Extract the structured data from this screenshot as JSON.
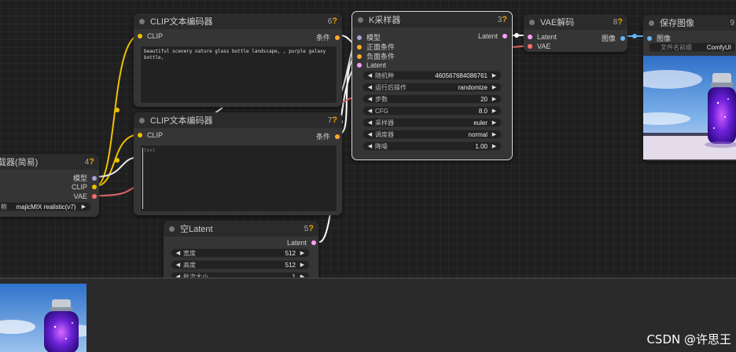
{
  "colors": {
    "clip": "#f0c000",
    "conditioning": "#ffa931",
    "model": "#b39ddb",
    "latent": "#ff9cf9",
    "vae": "#ff6e6e",
    "image": "#64b5f6"
  },
  "nodes": {
    "clip_text_pos": {
      "title": "CLIP文本编码器",
      "id": "6",
      "q": "?",
      "input_clip": "CLIP",
      "output": "条件",
      "text": "beautiful scenery nature glass bottle landscape, , purple galaxy bottle,"
    },
    "clip_text_neg": {
      "title": "CLIP文本编码器",
      "id": "7",
      "q": "?",
      "input_clip": "CLIP",
      "output": "条件",
      "text": "text"
    },
    "ksampler": {
      "title": "K采样器",
      "id": "3",
      "q": "?",
      "inputs": [
        "模型",
        "正面条件",
        "负面条件",
        "Latent"
      ],
      "output": "Latent",
      "widgets": [
        {
          "label": "随机种",
          "value": "460567684086761"
        },
        {
          "label": "运行后操作",
          "value": "randomize"
        },
        {
          "label": "步数",
          "value": "20"
        },
        {
          "label": "CFG",
          "value": "8.0"
        },
        {
          "label": "采样器",
          "value": "euler"
        },
        {
          "label": "调度器",
          "value": "normal"
        },
        {
          "label": "降噪",
          "value": "1.00"
        }
      ]
    },
    "vae_decode": {
      "title": "VAE解码",
      "id": "8",
      "q": "?",
      "inputs": [
        "Latent",
        "VAE"
      ],
      "output": "图像"
    },
    "save_image": {
      "title": "保存图像",
      "id": "9",
      "input": "图像",
      "widget_label": "文件名前缀",
      "widget_value": "ComfyUI"
    },
    "checkpoint_loader": {
      "title": "载器(简易)",
      "id": "4",
      "q": "?",
      "outputs": [
        "模型",
        "CLIP",
        "VAE"
      ],
      "widget_label": "称",
      "widget_value": "majicMIX realistic(v7)"
    },
    "empty_latent": {
      "title": "空Latent",
      "id": "5",
      "q": "?",
      "output": "Latent",
      "widgets": [
        {
          "label": "宽度",
          "value": "512"
        },
        {
          "label": "高度",
          "value": "512"
        },
        {
          "label": "批次大小",
          "value": "1"
        }
      ]
    }
  },
  "watermark": "CSDN @许思王"
}
